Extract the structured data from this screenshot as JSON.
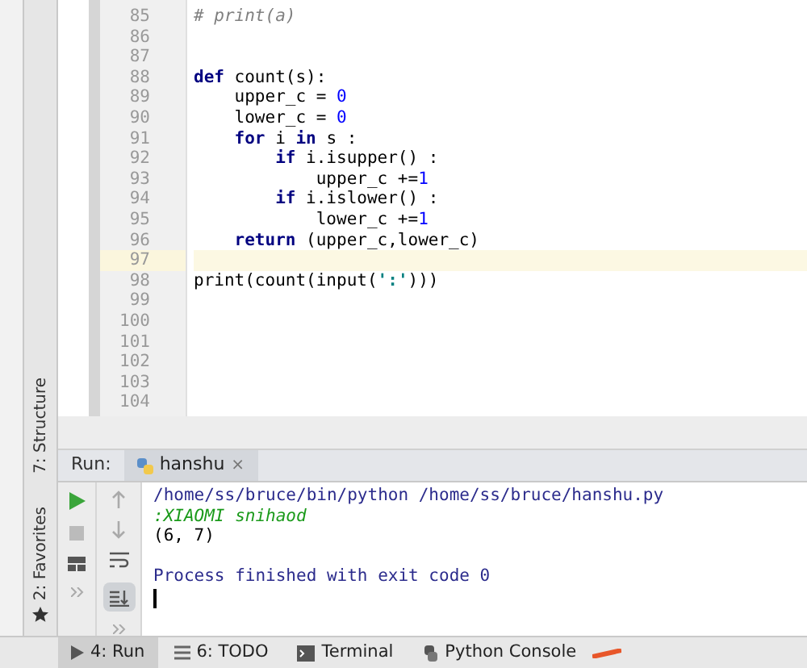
{
  "editor": {
    "lines": [
      {
        "number": "85",
        "current": false,
        "tokens": [
          {
            "kind": "comment",
            "text": "# print(a)"
          }
        ]
      },
      {
        "number": "86",
        "current": false
      },
      {
        "number": "87",
        "current": false
      },
      {
        "number": "88",
        "current": false,
        "tokens": [
          {
            "kind": "keyword",
            "text": "def"
          },
          {
            "kind": "plain",
            "text": " count(s):"
          }
        ]
      },
      {
        "number": "89",
        "current": false,
        "tokens": [
          {
            "kind": "plain",
            "text": "    upper_c = "
          },
          {
            "kind": "number",
            "text": "0"
          }
        ]
      },
      {
        "number": "90",
        "current": false,
        "tokens": [
          {
            "kind": "plain",
            "text": "    lower_c = "
          },
          {
            "kind": "number",
            "text": "0"
          }
        ]
      },
      {
        "number": "91",
        "current": false,
        "tokens": [
          {
            "kind": "keyword",
            "text": "    for"
          },
          {
            "kind": "plain",
            "text": " i "
          },
          {
            "kind": "keyword",
            "text": "in"
          },
          {
            "kind": "plain",
            "text": " s :"
          }
        ]
      },
      {
        "number": "92",
        "current": false,
        "tokens": [
          {
            "kind": "keyword",
            "text": "        if"
          },
          {
            "kind": "plain",
            "text": " i.isupper() :"
          }
        ]
      },
      {
        "number": "93",
        "current": false,
        "tokens": [
          {
            "kind": "plain",
            "text": "            upper_c +="
          },
          {
            "kind": "number",
            "text": "1"
          }
        ]
      },
      {
        "number": "94",
        "current": false,
        "tokens": [
          {
            "kind": "keyword",
            "text": "        if"
          },
          {
            "kind": "plain",
            "text": " i.islower() :"
          }
        ]
      },
      {
        "number": "95",
        "current": false,
        "tokens": [
          {
            "kind": "plain",
            "text": "            lower_c +="
          },
          {
            "kind": "number",
            "text": "1"
          }
        ]
      },
      {
        "number": "96",
        "current": false,
        "tokens": [
          {
            "kind": "keyword",
            "text": "    return"
          },
          {
            "kind": "plain",
            "text": " (upper_c,lower_c)"
          }
        ]
      },
      {
        "number": "97",
        "current": true
      },
      {
        "number": "98",
        "current": false,
        "tokens": [
          {
            "kind": "plain",
            "text": "print(count(input("
          },
          {
            "kind": "string",
            "text": "':'"
          },
          {
            "kind": "plain",
            "text": ")))"
          }
        ]
      },
      {
        "number": "99",
        "current": false
      },
      {
        "number": "100",
        "current": false
      },
      {
        "number": "101",
        "current": false
      },
      {
        "number": "102",
        "current": false
      },
      {
        "number": "103",
        "current": false
      },
      {
        "number": "104",
        "current": false
      }
    ]
  },
  "side_stripe": {
    "structure": "7: Structure",
    "favorites": "2: Favorites"
  },
  "run_panel": {
    "label": "Run:",
    "tab": "hanshu",
    "close": "×",
    "console": [
      {
        "kind": "command",
        "text": "/home/ss/bruce/bin/python /home/ss/bruce/hanshu.py"
      },
      {
        "kind": "input",
        "text": ":XIAOMI snihaod"
      },
      {
        "kind": "output",
        "text": "(6, 7)"
      },
      {
        "kind": "system",
        "text": "Process finished with exit code 0"
      }
    ]
  },
  "bottom_bar": [
    {
      "label": "4: Run",
      "kind": "run",
      "selected": true
    },
    {
      "label": "6: TODO",
      "kind": "todo",
      "selected": false
    },
    {
      "label": "Terminal",
      "kind": "terminal",
      "selected": false
    },
    {
      "label": "Python Console",
      "kind": "python",
      "selected": false
    }
  ]
}
